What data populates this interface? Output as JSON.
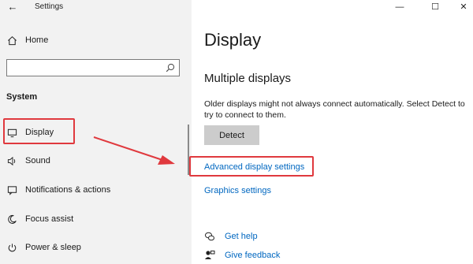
{
  "window": {
    "title": "Settings",
    "back": "←",
    "minimize": "—",
    "maximize": "☐",
    "close": "✕"
  },
  "sidebar": {
    "home": "Home",
    "search_placeholder": "",
    "section": "System",
    "items": [
      {
        "label": "Display",
        "icon": "monitor-icon"
      },
      {
        "label": "Sound",
        "icon": "speaker-icon"
      },
      {
        "label": "Notifications & actions",
        "icon": "notification-icon"
      },
      {
        "label": "Focus assist",
        "icon": "moon-icon"
      },
      {
        "label": "Power & sleep",
        "icon": "power-icon"
      }
    ]
  },
  "main": {
    "title": "Display",
    "section": "Multiple displays",
    "description": "Older displays might not always connect automatically. Select Detect to try to connect to them.",
    "detect_button": "Detect",
    "advanced_link": "Advanced display settings",
    "graphics_link": "Graphics settings",
    "get_help": "Get help",
    "give_feedback": "Give feedback"
  },
  "colors": {
    "accent": "#0067c0",
    "highlight": "#e0393e",
    "sidebar_bg": "#f2f2f2"
  }
}
